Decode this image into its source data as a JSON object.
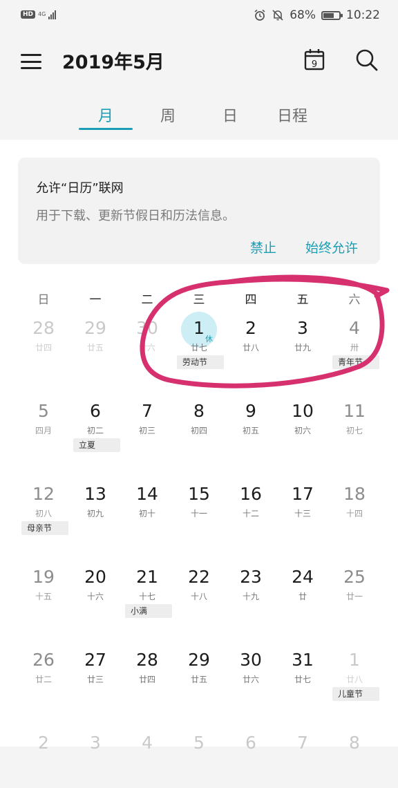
{
  "status_bar": {
    "hd": "HD",
    "network": "4G",
    "battery_text": "68%",
    "battery_level": 0.68,
    "time": "10:22",
    "icons": [
      "alarm-icon",
      "mute-icon",
      "battery-icon",
      "signal-icon"
    ]
  },
  "app_bar": {
    "title": "2019年5月",
    "today_icon_number": "9",
    "icons": [
      "menu-icon",
      "today-icon",
      "search-icon"
    ]
  },
  "tabs": {
    "items": [
      "月",
      "周",
      "日",
      "日程"
    ],
    "active_index": 0
  },
  "permission_card": {
    "title": "允许“日历”联网",
    "description": "用于下载、更新节假日和历法信息。",
    "deny_label": "禁止",
    "allow_label": "始终允许"
  },
  "weekdays": [
    "日",
    "一",
    "二",
    "三",
    "四",
    "五",
    "六"
  ],
  "weeks": [
    {
      "days": [
        {
          "num": "28",
          "lunar": "廿四",
          "other": true
        },
        {
          "num": "29",
          "lunar": "廿五",
          "other": true
        },
        {
          "num": "30",
          "lunar": "廿六",
          "other": true
        },
        {
          "num": "1",
          "lunar": "廿七",
          "today": true,
          "holiday": "休"
        },
        {
          "num": "2",
          "lunar": "廿八"
        },
        {
          "num": "3",
          "lunar": "廿九"
        },
        {
          "num": "4",
          "lunar": "卅"
        }
      ],
      "events": [
        {
          "label": "劳动节"
        },
        {
          "label": "青年节"
        }
      ]
    },
    {
      "days": [
        {
          "num": "5",
          "lunar": "四月"
        },
        {
          "num": "6",
          "lunar": "初二"
        },
        {
          "num": "7",
          "lunar": "初三"
        },
        {
          "num": "8",
          "lunar": "初四"
        },
        {
          "num": "9",
          "lunar": "初五"
        },
        {
          "num": "10",
          "lunar": "初六"
        },
        {
          "num": "11",
          "lunar": "初七"
        }
      ],
      "events": [
        {
          "label": "立夏"
        }
      ]
    },
    {
      "days": [
        {
          "num": "12",
          "lunar": "初八"
        },
        {
          "num": "13",
          "lunar": "初九"
        },
        {
          "num": "14",
          "lunar": "初十"
        },
        {
          "num": "15",
          "lunar": "十一"
        },
        {
          "num": "16",
          "lunar": "十二"
        },
        {
          "num": "17",
          "lunar": "十三"
        },
        {
          "num": "18",
          "lunar": "十四"
        }
      ],
      "events": [
        {
          "label": "母亲节"
        }
      ]
    },
    {
      "days": [
        {
          "num": "19",
          "lunar": "十五"
        },
        {
          "num": "20",
          "lunar": "十六"
        },
        {
          "num": "21",
          "lunar": "十七"
        },
        {
          "num": "22",
          "lunar": "十八"
        },
        {
          "num": "23",
          "lunar": "十九"
        },
        {
          "num": "24",
          "lunar": "廿"
        },
        {
          "num": "25",
          "lunar": "廿一"
        }
      ],
      "events": [
        {
          "label": "小满"
        }
      ]
    },
    {
      "days": [
        {
          "num": "26",
          "lunar": "廿二"
        },
        {
          "num": "27",
          "lunar": "廿三"
        },
        {
          "num": "28",
          "lunar": "廿四"
        },
        {
          "num": "29",
          "lunar": "廿五"
        },
        {
          "num": "30",
          "lunar": "廿六"
        },
        {
          "num": "31",
          "lunar": "廿七"
        },
        {
          "num": "1",
          "lunar": "廿八",
          "other": true
        }
      ],
      "events": [
        {
          "label": "儿童节"
        }
      ]
    },
    {
      "days": [
        {
          "num": "2",
          "lunar": "",
          "other": true
        },
        {
          "num": "3",
          "lunar": "",
          "other": true
        },
        {
          "num": "4",
          "lunar": "",
          "other": true
        },
        {
          "num": "5",
          "lunar": "",
          "other": true
        },
        {
          "num": "6",
          "lunar": "",
          "other": true
        },
        {
          "num": "7",
          "lunar": "",
          "other": true
        },
        {
          "num": "8",
          "lunar": "",
          "other": true
        }
      ],
      "events": []
    }
  ],
  "annotation": {
    "color": "#d6306f"
  }
}
